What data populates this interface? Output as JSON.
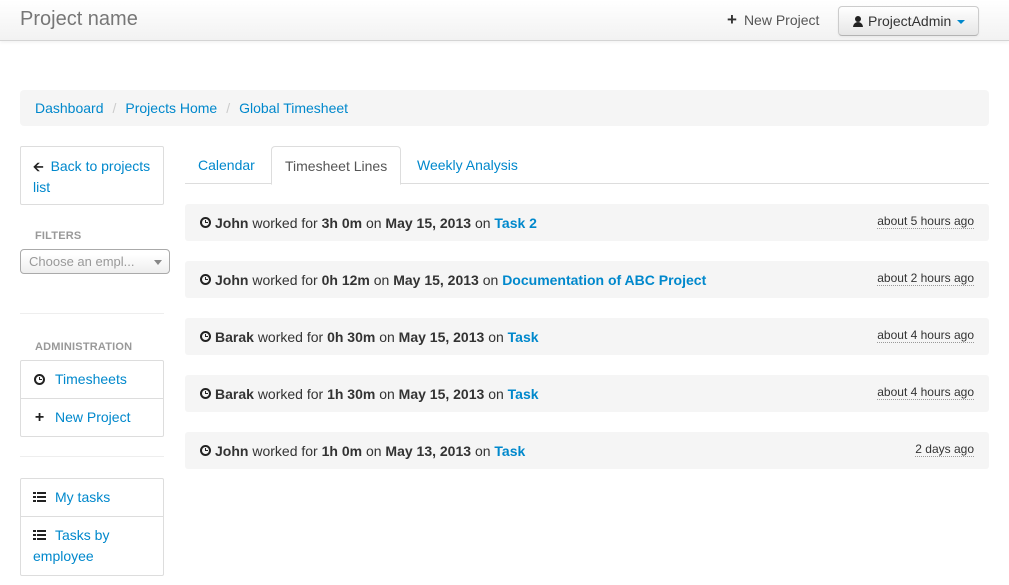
{
  "navbar": {
    "brand": "Project name",
    "new_project_label": "New Project",
    "user_label": "ProjectAdmin"
  },
  "breadcrumb": [
    "Dashboard",
    "Projects Home",
    "Global Timesheet"
  ],
  "sidebar": {
    "back_link": "Back to projects list",
    "filters_header": "FILTERS",
    "employee_select_placeholder": "Choose an empl...",
    "administration_header": "ADMINISTRATION",
    "admin_items": [
      {
        "icon": "clock-icon",
        "label": "Timesheets"
      },
      {
        "icon": "plus-icon",
        "label": "New Project"
      }
    ],
    "task_items": [
      {
        "icon": "list-icon",
        "label": "My tasks"
      },
      {
        "icon": "list-icon",
        "label": "Tasks by employee"
      }
    ]
  },
  "tabs": [
    {
      "label": "Calendar",
      "active": false
    },
    {
      "label": "Timesheet Lines",
      "active": true
    },
    {
      "label": "Weekly Analysis",
      "active": false
    }
  ],
  "timesheet_lines": [
    {
      "employee": "John",
      "text1": "worked for",
      "duration": "3h 0m",
      "text2": "on",
      "date": "May 15, 2013",
      "text3": "on",
      "task": "Task 2",
      "ago": "about 5 hours ago"
    },
    {
      "employee": "John",
      "text1": "worked for",
      "duration": "0h 12m",
      "text2": "on",
      "date": "May 15, 2013",
      "text3": "on",
      "task": "Documentation of ABC Project",
      "ago": "about 2 hours ago"
    },
    {
      "employee": "Barak",
      "text1": "worked for",
      "duration": "0h 30m",
      "text2": "on",
      "date": "May 15, 2013",
      "text3": "on",
      "task": "Task",
      "ago": "about 4 hours ago"
    },
    {
      "employee": "Barak",
      "text1": "worked for",
      "duration": "1h 30m",
      "text2": "on",
      "date": "May 15, 2013",
      "text3": "on",
      "task": "Task",
      "ago": "about 4 hours ago"
    },
    {
      "employee": "John",
      "text1": "worked for",
      "duration": "1h 0m",
      "text2": "on",
      "date": "May 13, 2013",
      "text3": "on",
      "task": "Task",
      "ago": "2 days ago"
    }
  ],
  "colors": {
    "link": "#0088cc",
    "row_background": "#f5f5f5",
    "muted_header": "#999999"
  }
}
